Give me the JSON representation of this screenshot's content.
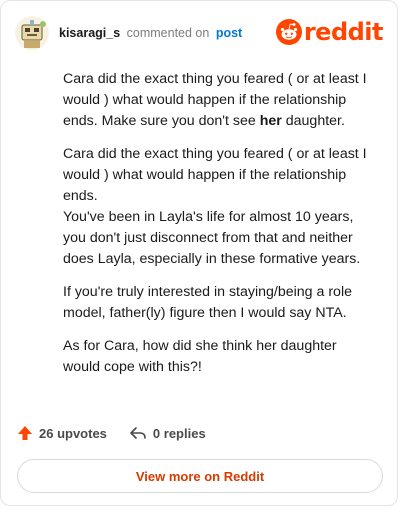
{
  "comment": {
    "username": "kisaragi_s",
    "commented_text": "commented on",
    "post_link": "post",
    "paragraphs": {
      "p1_before": "Cara did the exact thing you feared ( or at least I would ) what would happen if the relationship ends. Make sure you don't see ",
      "p1_bold": "her",
      "p1_after": " daughter.",
      "p2_line1": "Cara did the exact thing you feared ( or at least I would ) what would happen if the relationship ends.",
      "p2_line2": "You've been in Layla's life for almost 10 years, you don't just disconnect from that and neither does Layla, especially in these formative years.",
      "p3": "If you're truly interested in staying/being a role model, father(ly) figure then I would say NTA.",
      "p4": "As for Cara, how did she think her daughter would cope with this?!"
    }
  },
  "actions": {
    "upvotes": "26 upvotes",
    "replies": "0 replies"
  },
  "footer": {
    "view_more": "View more on Reddit"
  },
  "brand": {
    "logo_text": "reddit",
    "accent": "#ff4500",
    "link_color": "#0079d3"
  }
}
